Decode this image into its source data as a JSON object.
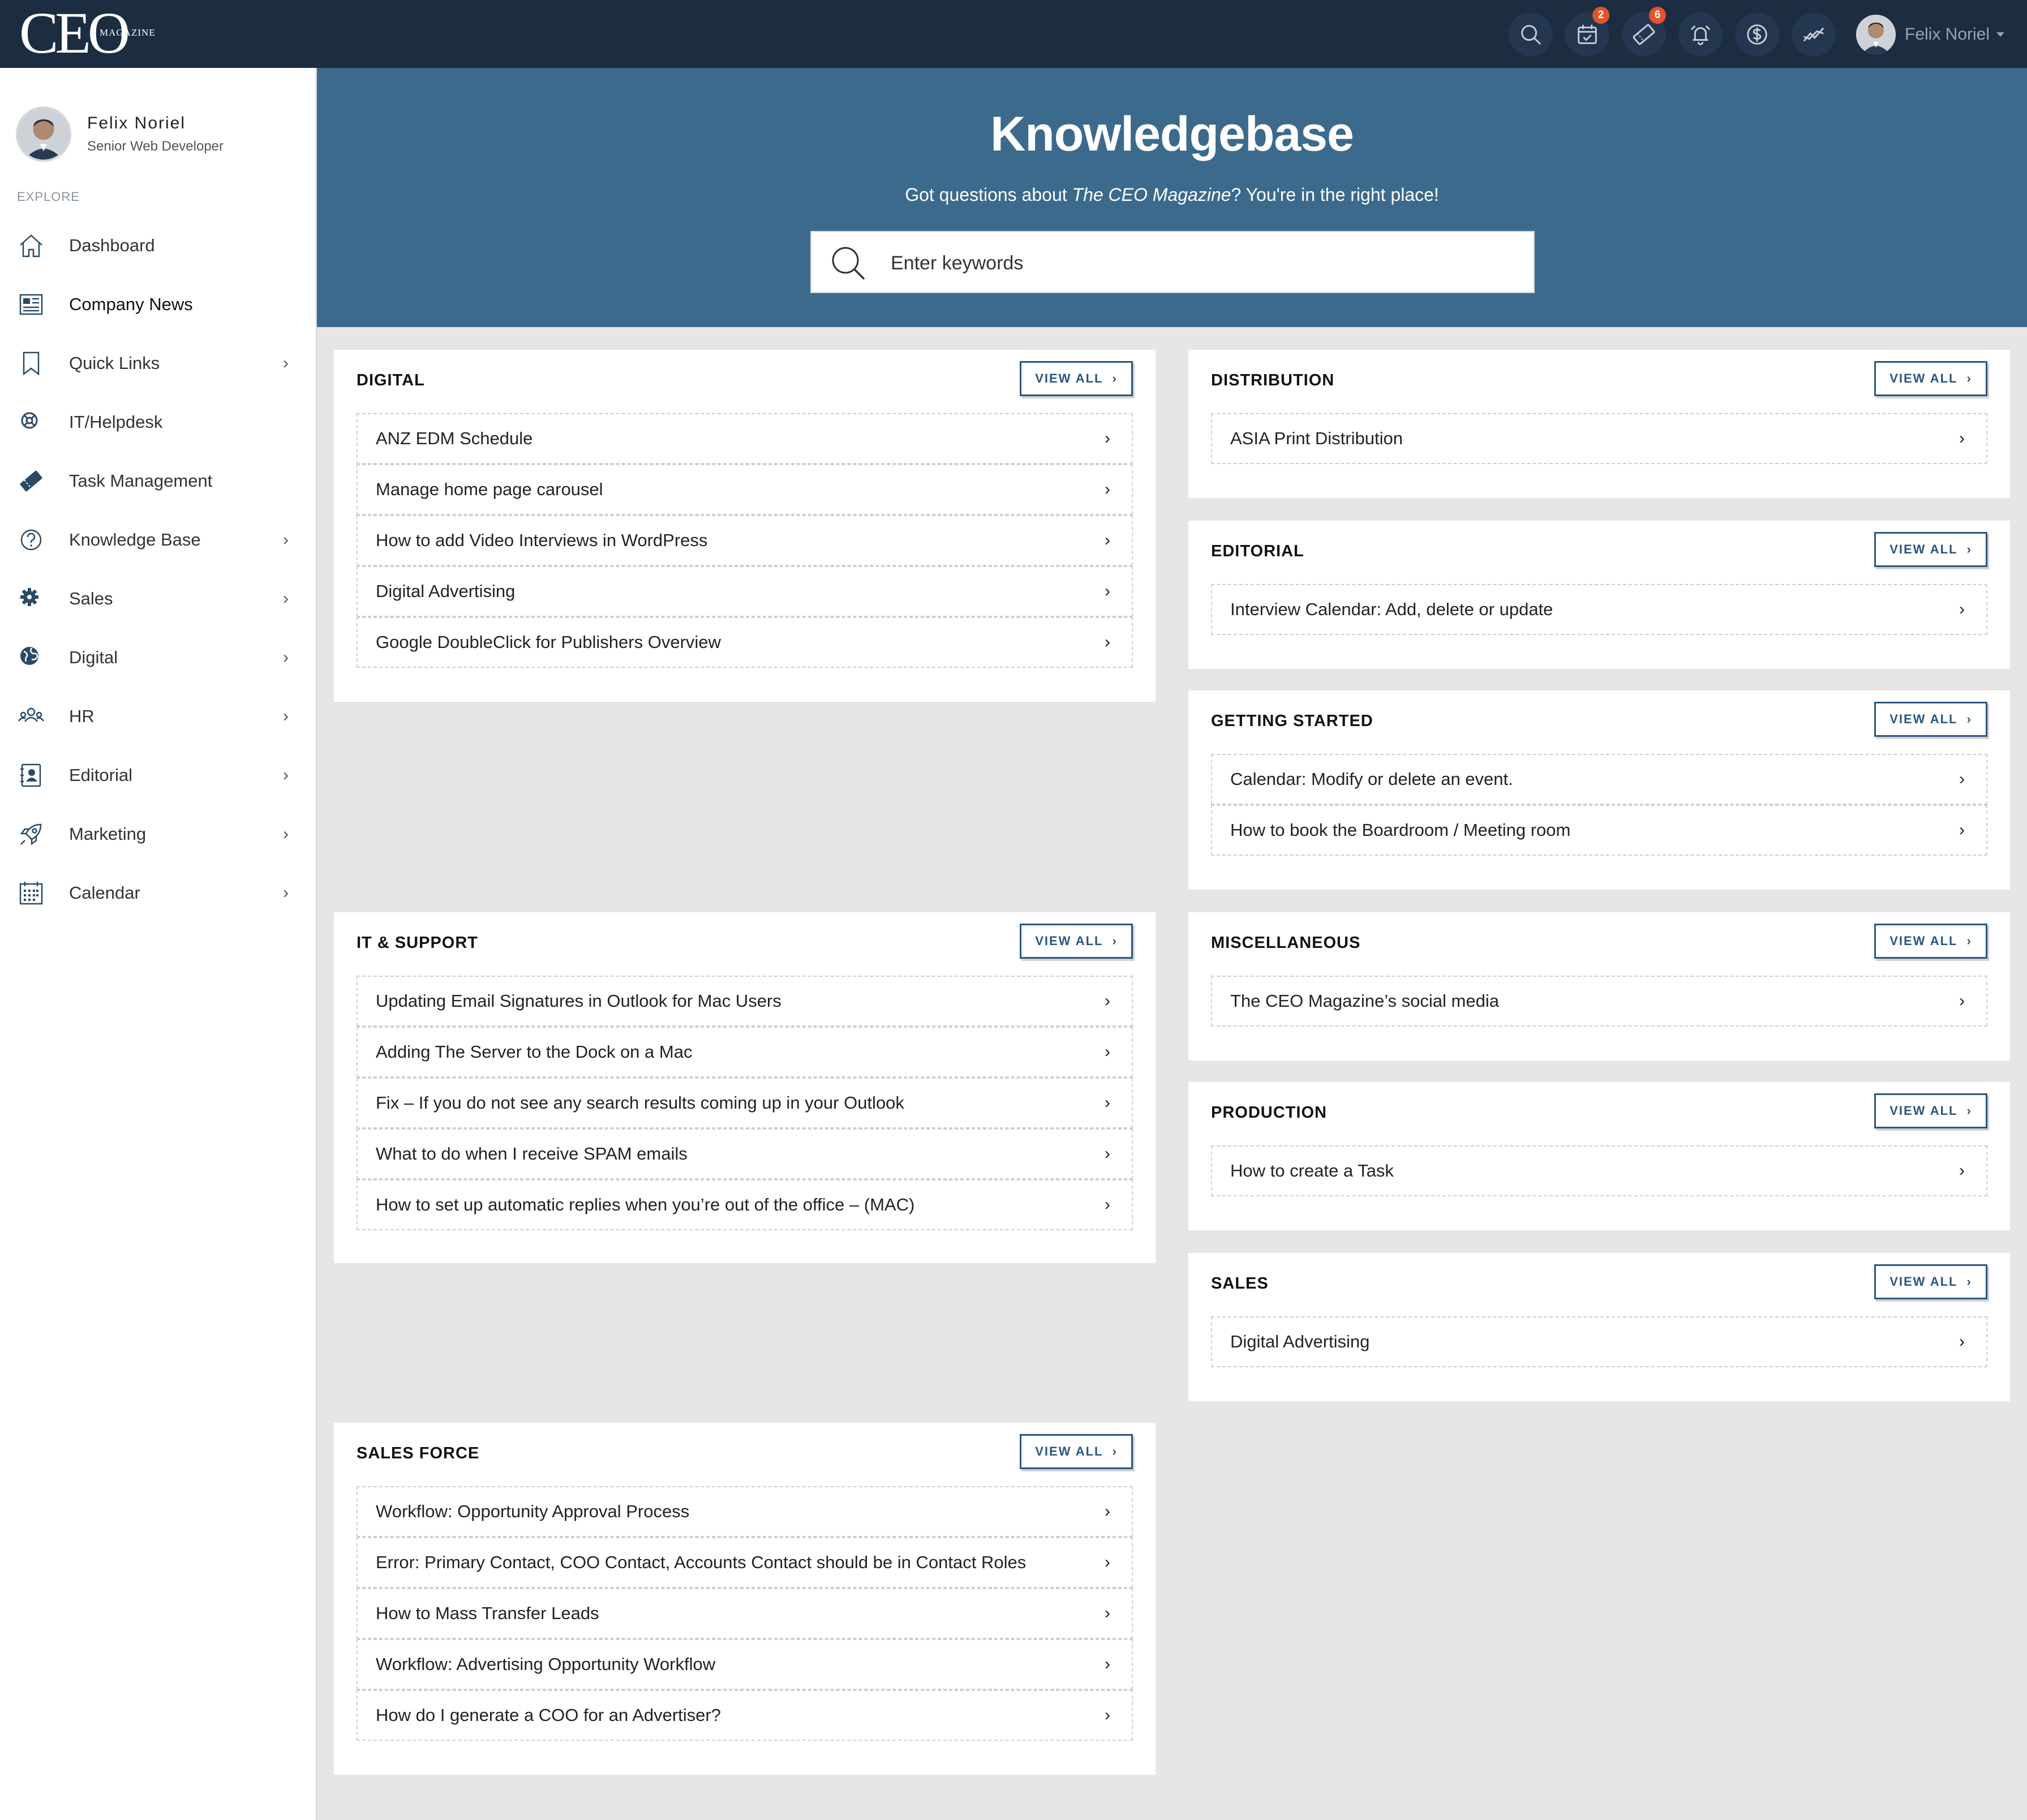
{
  "app": {
    "logo_text": "CEO",
    "logo_sub": "MAGAZINE"
  },
  "topbar": {
    "calendar_badge": "2",
    "tasks_badge": "6",
    "username": "Felix Noriel"
  },
  "sidebar": {
    "profile": {
      "name": "Felix Noriel",
      "role": "Senior Web Developer"
    },
    "section_label": "EXPLORE",
    "items": [
      {
        "label": "Dashboard",
        "icon": "home-icon",
        "chevron": ""
      },
      {
        "label": "Company News",
        "icon": "newspaper-icon",
        "chevron": ""
      },
      {
        "label": "Quick Links",
        "icon": "bookmark-icon",
        "chevron": "›"
      },
      {
        "label": "IT/Helpdesk",
        "icon": "lifebuoy-icon",
        "chevron": ""
      },
      {
        "label": "Task Management",
        "icon": "ticket-icon",
        "chevron": ""
      },
      {
        "label": "Knowledge Base",
        "icon": "question-icon",
        "chevron": "›"
      },
      {
        "label": "Sales",
        "icon": "gear-badge-icon",
        "chevron": "›"
      },
      {
        "label": "Digital",
        "icon": "globe-icon",
        "chevron": "›"
      },
      {
        "label": "HR",
        "icon": "people-icon",
        "chevron": "›"
      },
      {
        "label": "Editorial",
        "icon": "contact-card-icon",
        "chevron": "›"
      },
      {
        "label": "Marketing",
        "icon": "rocket-icon",
        "chevron": "›"
      },
      {
        "label": "Calendar",
        "icon": "calendar-grid-icon",
        "chevron": "›"
      }
    ]
  },
  "hero": {
    "title": "Knowledgebase",
    "subtitle_prefix": "Got questions about ",
    "subtitle_em": "The CEO Magazine",
    "subtitle_suffix": "? You're in the right place!",
    "search_placeholder": "Enter keywords"
  },
  "view_all_label": "VIEW ALL",
  "chevron": "›",
  "categories": {
    "digital": {
      "title": "DIGITAL",
      "items": [
        "ANZ EDM Schedule",
        "Manage home page carousel",
        "How to add Video Interviews in WordPress",
        "Digital Advertising",
        "Google DoubleClick for Publishers Overview"
      ]
    },
    "it_support": {
      "title": "IT & SUPPORT",
      "items": [
        "Updating Email Signatures in Outlook for Mac Users",
        "Adding The Server to the Dock on a Mac",
        "Fix – If you do not see any search results coming up in your Outlook",
        "What to do when I receive SPAM emails",
        "How to set up automatic replies when you’re out of the office – (MAC)"
      ]
    },
    "sales_force": {
      "title": "SALES FORCE",
      "items": [
        "Workflow: Opportunity Approval Process",
        "Error: Primary Contact, COO Contact, Accounts Contact should be in Contact Roles",
        "How to Mass Transfer Leads",
        "Workflow: Advertising Opportunity Workflow",
        "How do I generate a COO for an Advertiser?"
      ]
    },
    "distribution": {
      "title": "DISTRIBUTION",
      "items": [
        "ASIA Print Distribution"
      ]
    },
    "editorial": {
      "title": "EDITORIAL",
      "items": [
        "Interview Calendar: Add, delete or update"
      ]
    },
    "getting_started": {
      "title": "GETTING STARTED",
      "items": [
        "Calendar: Modify or delete an event.",
        "How to book the Boardroom / Meeting room"
      ]
    },
    "miscellaneous": {
      "title": "MISCELLANEOUS",
      "items": [
        "The CEO Magazine’s social media"
      ]
    },
    "production": {
      "title": "PRODUCTION",
      "items": [
        "How to create a Task"
      ]
    },
    "sales": {
      "title": "SALES",
      "items": [
        "Digital Advertising"
      ]
    }
  }
}
